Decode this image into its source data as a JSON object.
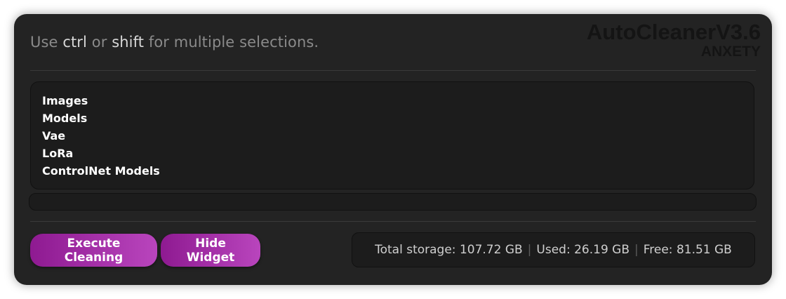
{
  "hint": {
    "prefix": "Use ",
    "key1": "ctrl",
    "middle": " or ",
    "key2": "shift",
    "suffix": " for multiple selections."
  },
  "brand": {
    "name": "AutoCleanerV3.6",
    "author": "ANXETY"
  },
  "list": {
    "items": [
      "Images",
      "Models",
      "Vae",
      "LoRa",
      "ControlNet Models"
    ]
  },
  "progress": {
    "value": 0
  },
  "buttons": {
    "execute_label": "Execute Cleaning",
    "hide_label": "Hide Widget"
  },
  "storage": {
    "total": "Total storage: 107.72 GB",
    "used": "Used: 26.19 GB",
    "free": "Free: 81.51 GB",
    "separator": "|"
  },
  "colors": {
    "accent_start": "#8e1a91",
    "accent_end": "#b945bd",
    "panel": "#232323"
  }
}
